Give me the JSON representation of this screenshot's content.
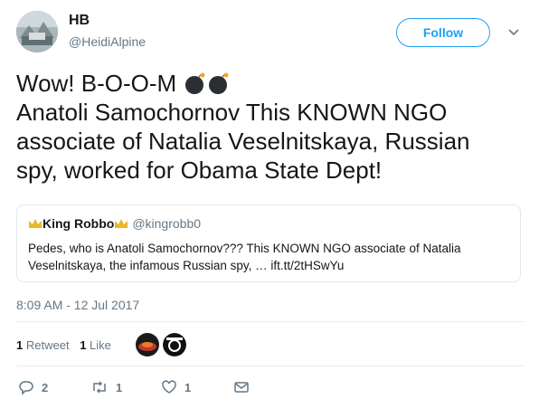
{
  "author": {
    "name": "HB",
    "handle": "@HeidiAlpine"
  },
  "follow_label": "Follow",
  "tweet": {
    "line1": "Wow!  B-O-O-M",
    "line2": "Anatoli Samochornov This KNOWN NGO",
    "line3": "associate of Natalia Veselnitskaya, Russian",
    "line4": "spy, worked for Obama State Dept!",
    "emoji": [
      "bomb",
      "bomb"
    ]
  },
  "quote": {
    "name": "King Robbo",
    "handle": "@kingrobb0",
    "line1": "Pedes, who is Anatoli Samochornov??? This KNOWN NGO associate of Natalia",
    "line2": "Veselnitskaya, the infamous Russian spy, … ift.tt/2tHSwYu"
  },
  "timestamp": "8:09 AM - 12 Jul 2017",
  "stats": {
    "retweets_count": "1",
    "retweets_label": "Retweet",
    "likes_count": "1",
    "likes_label": "Like"
  },
  "actions": {
    "replies": "2",
    "retweets": "1",
    "likes": "1"
  },
  "colors": {
    "accent": "#1da1f2",
    "muted": "#657786",
    "border": "#e1e8ed"
  }
}
